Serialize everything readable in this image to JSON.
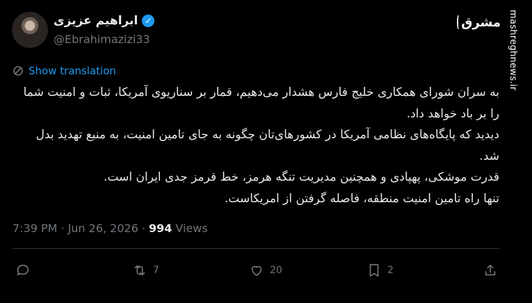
{
  "author": {
    "display_name": "ابراهیم عزیزی",
    "handle": "@Ebrahimazizi33"
  },
  "brand": {
    "logo_text": "مشرق",
    "watermark": "mashreghnews.ir"
  },
  "translate_label": "Show translation",
  "tweet": {
    "paragraphs": [
      "به سران شورای همکاری خلیج فارس هشدار می‌دهیم، قمار بر سناریوی آمریکا، ثبات و امنیت شما را بر باد خواهد داد.",
      "دیدید که پایگاه‌های نظامی آمریکا در کشورهای‌تان چگونه به جای تامین امنیت، به منبع تهدید بدل شد.",
      "قدرت موشکی، پهپادی و همچنین مدیریت تنگه هرمز، خط قرمز جدی ایران است.",
      "تنها راه تامین امنیت منطقه، فاصله گرفتن از امریکاست."
    ]
  },
  "meta": {
    "time": "7:39 PM",
    "separator": "·",
    "date": "Jun 26, 2026",
    "views_count": "994",
    "views_label": "Views"
  },
  "actions": {
    "reply_count": "",
    "retweet_count": "7",
    "like_count": "20",
    "bookmark_count": "2"
  },
  "colors": {
    "background": "#000000",
    "text": "#e7e9ea",
    "muted": "#71767b",
    "accent": "#1d9bf0"
  }
}
